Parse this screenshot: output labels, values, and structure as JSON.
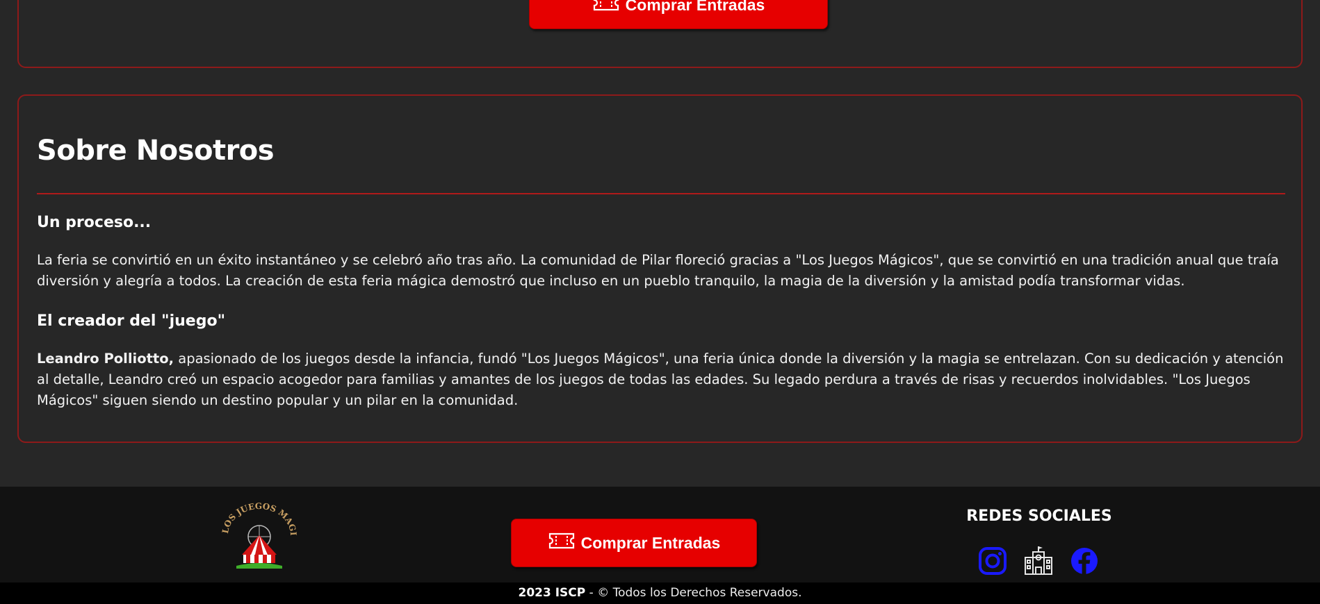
{
  "top_section": {
    "buy_button_label": "Comprar Entradas"
  },
  "about": {
    "title": "Sobre Nosotros",
    "subheading_1": "Un proceso...",
    "paragraph_1": "La feria se convirtió en un éxito instantáneo y se celebró año tras año. La comunidad de Pilar floreció gracias a \"Los Juegos Mágicos\", que se convirtió en una tradición anual que traía diversión y alegría a todos. La creación de esta feria mágica demostró que incluso en un pueblo tranquilo, la magia de la diversión y la amistad podía transformar vidas.",
    "subheading_2": "El creador del \"juego\"",
    "founder_name": "Leandro Polliotto,",
    "paragraph_2": " apasionado de los juegos desde la infancia, fundó \"Los Juegos Mágicos\", una feria única donde la diversión y la magia se entrelazan. Con su dedicación y atención al detalle, Leandro creó un espacio acogedor para familias y amantes de los juegos de todas las edades. Su legado perdura a través de risas y recuerdos inolvidables. \"Los Juegos Mágicos\" siguen siendo un destino popular y un pilar en la comunidad."
  },
  "footer": {
    "logo_text": "LOS JUEGOS MAGICOS",
    "buy_button_label": "Comprar Entradas",
    "social_title": "REDES SOCIALES",
    "social_icons": [
      "instagram-icon",
      "school-building-icon",
      "facebook-icon"
    ],
    "copyright_year": "2023 ISCP",
    "copyright_text": " - © Todos los Derechos Reservados."
  },
  "colors": {
    "background": "#272727",
    "accent_red": "#e60000",
    "card_border": "#8e1a1a",
    "footer_bg": "#121212",
    "social_blue": "#1a1aff"
  }
}
